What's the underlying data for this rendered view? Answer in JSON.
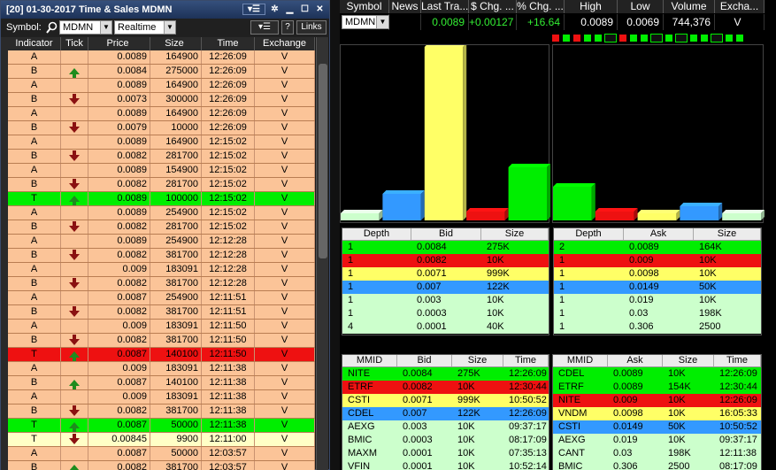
{
  "colors": {
    "green": "#00ee00",
    "red": "#ee1111",
    "yellow": "#ffff66",
    "blue": "#3399ff",
    "light_green": "#ccffcc",
    "salmon": "#fbc498"
  },
  "time_sales": {
    "title": "[20] 01-30-2017 Time & Sales MDMN",
    "symbol_label": "Symbol:",
    "symbol_value": "MDMN",
    "feed_value": "Realtime",
    "help_label": "?",
    "links_label": "Links",
    "columns": [
      "Indicator",
      "Tick",
      "Price",
      "Size",
      "Time",
      "Exchange"
    ],
    "rows": [
      {
        "ind": "A",
        "tick": "",
        "price": "0.0089",
        "size": "164900",
        "time": "12:26:09",
        "exch": "V",
        "style": ""
      },
      {
        "ind": "B",
        "tick": "up",
        "price": "0.0084",
        "size": "275000",
        "time": "12:26:09",
        "exch": "V",
        "style": ""
      },
      {
        "ind": "A",
        "tick": "",
        "price": "0.0089",
        "size": "164900",
        "time": "12:26:09",
        "exch": "V",
        "style": ""
      },
      {
        "ind": "B",
        "tick": "down",
        "price": "0.0073",
        "size": "300000",
        "time": "12:26:09",
        "exch": "V",
        "style": ""
      },
      {
        "ind": "A",
        "tick": "",
        "price": "0.0089",
        "size": "164900",
        "time": "12:26:09",
        "exch": "V",
        "style": ""
      },
      {
        "ind": "B",
        "tick": "down",
        "price": "0.0079",
        "size": "10000",
        "time": "12:26:09",
        "exch": "V",
        "style": ""
      },
      {
        "ind": "A",
        "tick": "",
        "price": "0.0089",
        "size": "164900",
        "time": "12:15:02",
        "exch": "V",
        "style": ""
      },
      {
        "ind": "B",
        "tick": "down",
        "price": "0.0082",
        "size": "281700",
        "time": "12:15:02",
        "exch": "V",
        "style": ""
      },
      {
        "ind": "A",
        "tick": "",
        "price": "0.0089",
        "size": "154900",
        "time": "12:15:02",
        "exch": "V",
        "style": ""
      },
      {
        "ind": "B",
        "tick": "down",
        "price": "0.0082",
        "size": "281700",
        "time": "12:15:02",
        "exch": "V",
        "style": ""
      },
      {
        "ind": "T",
        "tick": "up",
        "price": "0.0089",
        "size": "100000",
        "time": "12:15:02",
        "exch": "V",
        "style": "T"
      },
      {
        "ind": "A",
        "tick": "",
        "price": "0.0089",
        "size": "254900",
        "time": "12:15:02",
        "exch": "V",
        "style": ""
      },
      {
        "ind": "B",
        "tick": "down",
        "price": "0.0082",
        "size": "281700",
        "time": "12:15:02",
        "exch": "V",
        "style": ""
      },
      {
        "ind": "A",
        "tick": "",
        "price": "0.0089",
        "size": "254900",
        "time": "12:12:28",
        "exch": "V",
        "style": ""
      },
      {
        "ind": "B",
        "tick": "down",
        "price": "0.0082",
        "size": "381700",
        "time": "12:12:28",
        "exch": "V",
        "style": ""
      },
      {
        "ind": "A",
        "tick": "",
        "price": "0.009",
        "size": "183091",
        "time": "12:12:28",
        "exch": "V",
        "style": ""
      },
      {
        "ind": "B",
        "tick": "down",
        "price": "0.0082",
        "size": "381700",
        "time": "12:12:28",
        "exch": "V",
        "style": ""
      },
      {
        "ind": "A",
        "tick": "",
        "price": "0.0087",
        "size": "254900",
        "time": "12:11:51",
        "exch": "V",
        "style": ""
      },
      {
        "ind": "B",
        "tick": "down",
        "price": "0.0082",
        "size": "381700",
        "time": "12:11:51",
        "exch": "V",
        "style": ""
      },
      {
        "ind": "A",
        "tick": "",
        "price": "0.009",
        "size": "183091",
        "time": "12:11:50",
        "exch": "V",
        "style": ""
      },
      {
        "ind": "B",
        "tick": "down",
        "price": "0.0082",
        "size": "381700",
        "time": "12:11:50",
        "exch": "V",
        "style": ""
      },
      {
        "ind": "T",
        "tick": "up",
        "price": "0.0087",
        "size": "140100",
        "time": "12:11:50",
        "exch": "V",
        "style": "red"
      },
      {
        "ind": "A",
        "tick": "",
        "price": "0.009",
        "size": "183091",
        "time": "12:11:38",
        "exch": "V",
        "style": ""
      },
      {
        "ind": "B",
        "tick": "up",
        "price": "0.0087",
        "size": "140100",
        "time": "12:11:38",
        "exch": "V",
        "style": ""
      },
      {
        "ind": "A",
        "tick": "",
        "price": "0.009",
        "size": "183091",
        "time": "12:11:38",
        "exch": "V",
        "style": ""
      },
      {
        "ind": "B",
        "tick": "down",
        "price": "0.0082",
        "size": "381700",
        "time": "12:11:38",
        "exch": "V",
        "style": ""
      },
      {
        "ind": "T",
        "tick": "up",
        "price": "0.0087",
        "size": "50000",
        "time": "12:11:38",
        "exch": "V",
        "style": "T"
      },
      {
        "ind": "T",
        "tick": "down",
        "price": "0.00845",
        "size": "9900",
        "time": "12:11:00",
        "exch": "V",
        "style": "cream"
      },
      {
        "ind": "A",
        "tick": "",
        "price": "0.0087",
        "size": "50000",
        "time": "12:03:57",
        "exch": "V",
        "style": ""
      },
      {
        "ind": "B",
        "tick": "up",
        "price": "0.0082",
        "size": "381700",
        "time": "12:03:57",
        "exch": "V",
        "style": ""
      }
    ]
  },
  "quote": {
    "columns": [
      "Symbol",
      "News",
      "Last Tra...",
      "$ Chg. ...",
      "% Chg. ...",
      "High",
      "Low",
      "Volume",
      "Excha..."
    ],
    "symbol": "MDMN",
    "last": "0.0089",
    "dollar_change": "+0.00127",
    "percent_change": "+16.64",
    "high": "0.0089",
    "low": "0.0069",
    "volume": "744,376",
    "exchange": "V",
    "indicator_blocks": [
      "red",
      "green",
      "red",
      "green",
      "green",
      "black",
      "red",
      "green",
      "green",
      "black",
      "green",
      "black",
      "green",
      "green",
      "black",
      "green",
      "green"
    ]
  },
  "depth_bid": {
    "columns": [
      "Depth",
      "Bid",
      "Size"
    ],
    "rows": [
      {
        "depth": "1",
        "price": "0.0084",
        "size": "275K",
        "color": "green"
      },
      {
        "depth": "1",
        "price": "0.0082",
        "size": "10K",
        "color": "red"
      },
      {
        "depth": "1",
        "price": "0.0071",
        "size": "999K",
        "color": "yellow"
      },
      {
        "depth": "1",
        "price": "0.007",
        "size": "122K",
        "color": "blue"
      },
      {
        "depth": "1",
        "price": "0.003",
        "size": "10K",
        "color": "light_green"
      },
      {
        "depth": "1",
        "price": "0.0003",
        "size": "10K",
        "color": "light_green"
      },
      {
        "depth": "4",
        "price": "0.0001",
        "size": "40K",
        "color": "light_green"
      }
    ]
  },
  "depth_ask": {
    "columns": [
      "Depth",
      "Ask",
      "Size"
    ],
    "rows": [
      {
        "depth": "2",
        "price": "0.0089",
        "size": "164K",
        "color": "green"
      },
      {
        "depth": "1",
        "price": "0.009",
        "size": "10K",
        "color": "red"
      },
      {
        "depth": "1",
        "price": "0.0098",
        "size": "10K",
        "color": "yellow"
      },
      {
        "depth": "1",
        "price": "0.0149",
        "size": "50K",
        "color": "blue"
      },
      {
        "depth": "1",
        "price": "0.019",
        "size": "10K",
        "color": "light_green"
      },
      {
        "depth": "1",
        "price": "0.03",
        "size": "198K",
        "color": "light_green"
      },
      {
        "depth": "1",
        "price": "0.306",
        "size": "2500",
        "color": "light_green"
      }
    ]
  },
  "mm_bid": {
    "columns": [
      "MMID",
      "Bid",
      "Size",
      "Time"
    ],
    "rows": [
      {
        "mmid": "NITE",
        "price": "0.0084",
        "size": "275K",
        "time": "12:26:09",
        "color": "green"
      },
      {
        "mmid": "ETRF",
        "price": "0.0082",
        "size": "10K",
        "time": "12:30:44",
        "color": "red"
      },
      {
        "mmid": "CSTI",
        "price": "0.0071",
        "size": "999K",
        "time": "10:50:52",
        "color": "yellow"
      },
      {
        "mmid": "CDEL",
        "price": "0.007",
        "size": "122K",
        "time": "12:26:09",
        "color": "blue"
      },
      {
        "mmid": "AEXG",
        "price": "0.003",
        "size": "10K",
        "time": "09:37:17",
        "color": "light_green"
      },
      {
        "mmid": "BMIC",
        "price": "0.0003",
        "size": "10K",
        "time": "08:17:09",
        "color": "light_green"
      },
      {
        "mmid": "MAXM",
        "price": "0.0001",
        "size": "10K",
        "time": "07:35:13",
        "color": "light_green"
      },
      {
        "mmid": "VFIN",
        "price": "0.0001",
        "size": "10K",
        "time": "10:52:14",
        "color": "light_green"
      }
    ]
  },
  "mm_ask": {
    "columns": [
      "MMID",
      "Ask",
      "Size",
      "Time"
    ],
    "rows": [
      {
        "mmid": "CDEL",
        "price": "0.0089",
        "size": "10K",
        "time": "12:26:09",
        "color": "green"
      },
      {
        "mmid": "ETRF",
        "price": "0.0089",
        "size": "154K",
        "time": "12:30:44",
        "color": "green"
      },
      {
        "mmid": "NITE",
        "price": "0.009",
        "size": "10K",
        "time": "12:26:09",
        "color": "red"
      },
      {
        "mmid": "VNDM",
        "price": "0.0098",
        "size": "10K",
        "time": "16:05:33",
        "color": "yellow"
      },
      {
        "mmid": "CSTI",
        "price": "0.0149",
        "size": "50K",
        "time": "10:50:52",
        "color": "blue"
      },
      {
        "mmid": "AEXG",
        "price": "0.019",
        "size": "10K",
        "time": "09:37:17",
        "color": "light_green"
      },
      {
        "mmid": "CANT",
        "price": "0.03",
        "size": "198K",
        "time": "12:11:38",
        "color": "light_green"
      },
      {
        "mmid": "BMIC",
        "price": "0.306",
        "size": "2500",
        "time": "08:17:09",
        "color": "light_green"
      }
    ]
  },
  "depth_chart": {
    "bid_bars": [
      {
        "color": "light_green",
        "value": 8
      },
      {
        "color": "blue",
        "value": 30
      },
      {
        "color": "yellow",
        "value": 196
      },
      {
        "color": "red",
        "value": 10
      },
      {
        "color": "green",
        "value": 60
      }
    ],
    "ask_bars": [
      {
        "color": "green",
        "value": 38
      },
      {
        "color": "red",
        "value": 10
      },
      {
        "color": "yellow",
        "value": 8
      },
      {
        "color": "blue",
        "value": 16
      },
      {
        "color": "light_green",
        "value": 8
      }
    ]
  }
}
